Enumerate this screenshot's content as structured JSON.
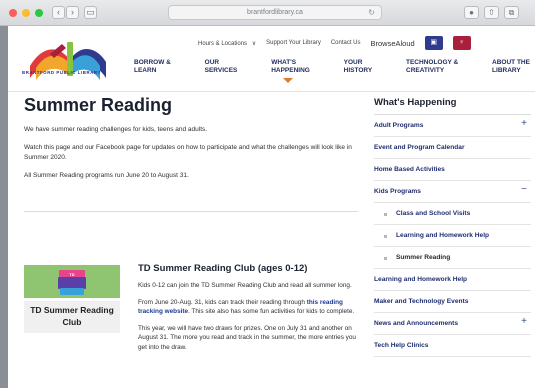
{
  "browser": {
    "url": "brantfordlibrary.ca",
    "back_glyph": "‹",
    "forward_glyph": "›",
    "sidebar_glyph": "▭",
    "reload_glyph": "↻",
    "shield_glyph": "●",
    "share_glyph": "⇧",
    "tabs_glyph": "⧉"
  },
  "logo": {
    "text": "BRANTFORD PUBLIC LIBRARY",
    "colors": [
      "#e23a3a",
      "#f2a62b",
      "#2e3b8f",
      "#3aa0d8",
      "#86c440",
      "#a8203c"
    ]
  },
  "utility": {
    "hours": "Hours & Locations",
    "chevron_glyph": "∨",
    "support": "Support Your Library",
    "contact": "Contact Us",
    "browsealoud": "BrowseAloud",
    "blue_glyph": "▣",
    "red_glyph": "♀"
  },
  "nav": [
    {
      "label": "BORROW &\nLEARN"
    },
    {
      "label": "OUR\nSERVICES"
    },
    {
      "label": "WHAT'S\nHAPPENING",
      "active": true
    },
    {
      "label": "YOUR\nHISTORY"
    },
    {
      "label": "TECHNOLOGY &\nCREATIVITY"
    },
    {
      "label": "ABOUT THE\nLIBRARY"
    }
  ],
  "main": {
    "title": "Summer Reading",
    "paragraphs": [
      "We have summer reading challenges for kids, teens and adults.",
      "Watch this page and our Facebook page for updates on how to participate and what the challenges will look like in Summer 2020.",
      "All Summer Reading programs run June 20 to August 31."
    ],
    "card": {
      "logo_text": "TD Summer Reading Club",
      "name": "TD Summer Reading Club"
    },
    "article": {
      "heading": "TD Summer Reading Club (ages 0-12)",
      "p1": "Kids 0-12 can join the TD Summer Reading Club and read all summer long.",
      "p2_before": "From June 20-Aug. 31, kids can track their reading through ",
      "p2_link": "this reading tracking website",
      "p2_after": ". This site also has some fun activities for kids to complete.",
      "p3": "This year, we will have two draws for prizes. One on July 31 and another on August 31. The more you read and track in the summer, the more entries you get into the draw."
    }
  },
  "sidebar": {
    "heading": "What's Happening",
    "items": [
      {
        "label": "Adult Programs",
        "toggle": "+"
      },
      {
        "label": "Event and Program Calendar"
      },
      {
        "label": "Home Based Activities"
      },
      {
        "label": "Kids Programs",
        "toggle": "−"
      },
      {
        "label": "Class and School Visits",
        "sub": true
      },
      {
        "label": "Learning and Homework Help",
        "sub": true
      },
      {
        "label": "Summer Reading",
        "sub": true,
        "current": true
      },
      {
        "label": "Learning and Homework Help"
      },
      {
        "label": "Maker and Technology Events"
      },
      {
        "label": "News and Announcements",
        "toggle": "+"
      },
      {
        "label": "Tech Help Clinics"
      }
    ]
  }
}
